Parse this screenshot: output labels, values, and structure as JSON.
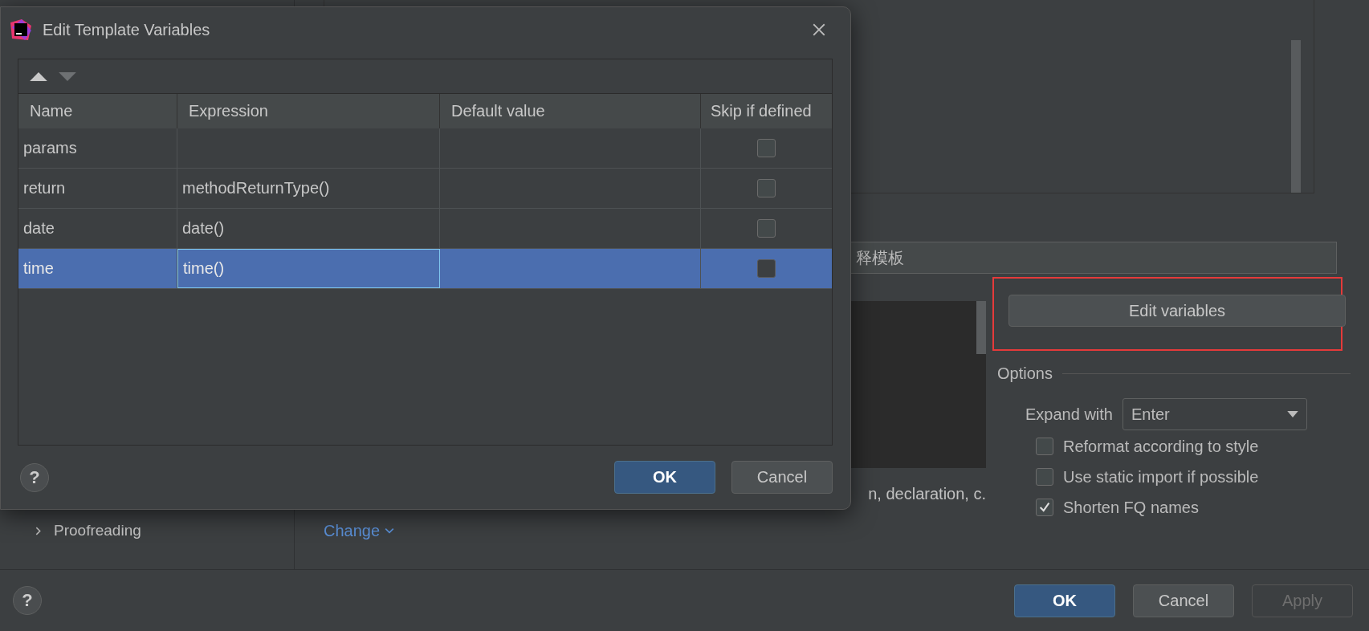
{
  "settings": {
    "help": "?",
    "sidebar": {
      "items": [
        {
          "label": "Proofreading",
          "expanded": false
        }
      ]
    },
    "template_text": "释模板",
    "edit_button": "Edit variables",
    "description": "n, declaration, c.",
    "change_link": "Change",
    "options": {
      "title": "Options",
      "expand_with": {
        "label": "Expand with",
        "value": "Enter"
      },
      "checkboxes": [
        {
          "label": "Reformat according to style",
          "checked": false
        },
        {
          "label": "Use static import if possible",
          "checked": false
        },
        {
          "label": "Shorten FQ names",
          "checked": true
        }
      ]
    },
    "buttons": [
      {
        "label": "OK",
        "primary": true,
        "disabled": false
      },
      {
        "label": "Cancel",
        "primary": false,
        "disabled": false
      },
      {
        "label": "Apply",
        "primary": false,
        "disabled": true
      }
    ]
  },
  "dialog": {
    "title": "Edit Template Variables",
    "toolbar": [
      {
        "kind": "up",
        "disabled": false
      },
      {
        "kind": "down",
        "disabled": true
      }
    ],
    "columns": [
      "Name",
      "Expression",
      "Default value",
      "Skip if defined"
    ],
    "rows": [
      {
        "name": "params",
        "selected": false,
        "editing": false,
        "skip_if_defined": false
      },
      {
        "name": "return",
        "expression": "methodReturnType()",
        "selected": false,
        "editing": false,
        "skip_if_defined": false
      },
      {
        "name": "date",
        "expression": "date()",
        "selected": false,
        "editing": false,
        "skip_if_defined": false
      },
      {
        "name": "time",
        "expression": "time()",
        "selected": true,
        "editing": true,
        "skip_if_defined": false
      }
    ],
    "help": "?",
    "buttons": [
      {
        "label": "OK",
        "primary": true
      },
      {
        "label": "Cancel",
        "primary": false
      }
    ]
  }
}
